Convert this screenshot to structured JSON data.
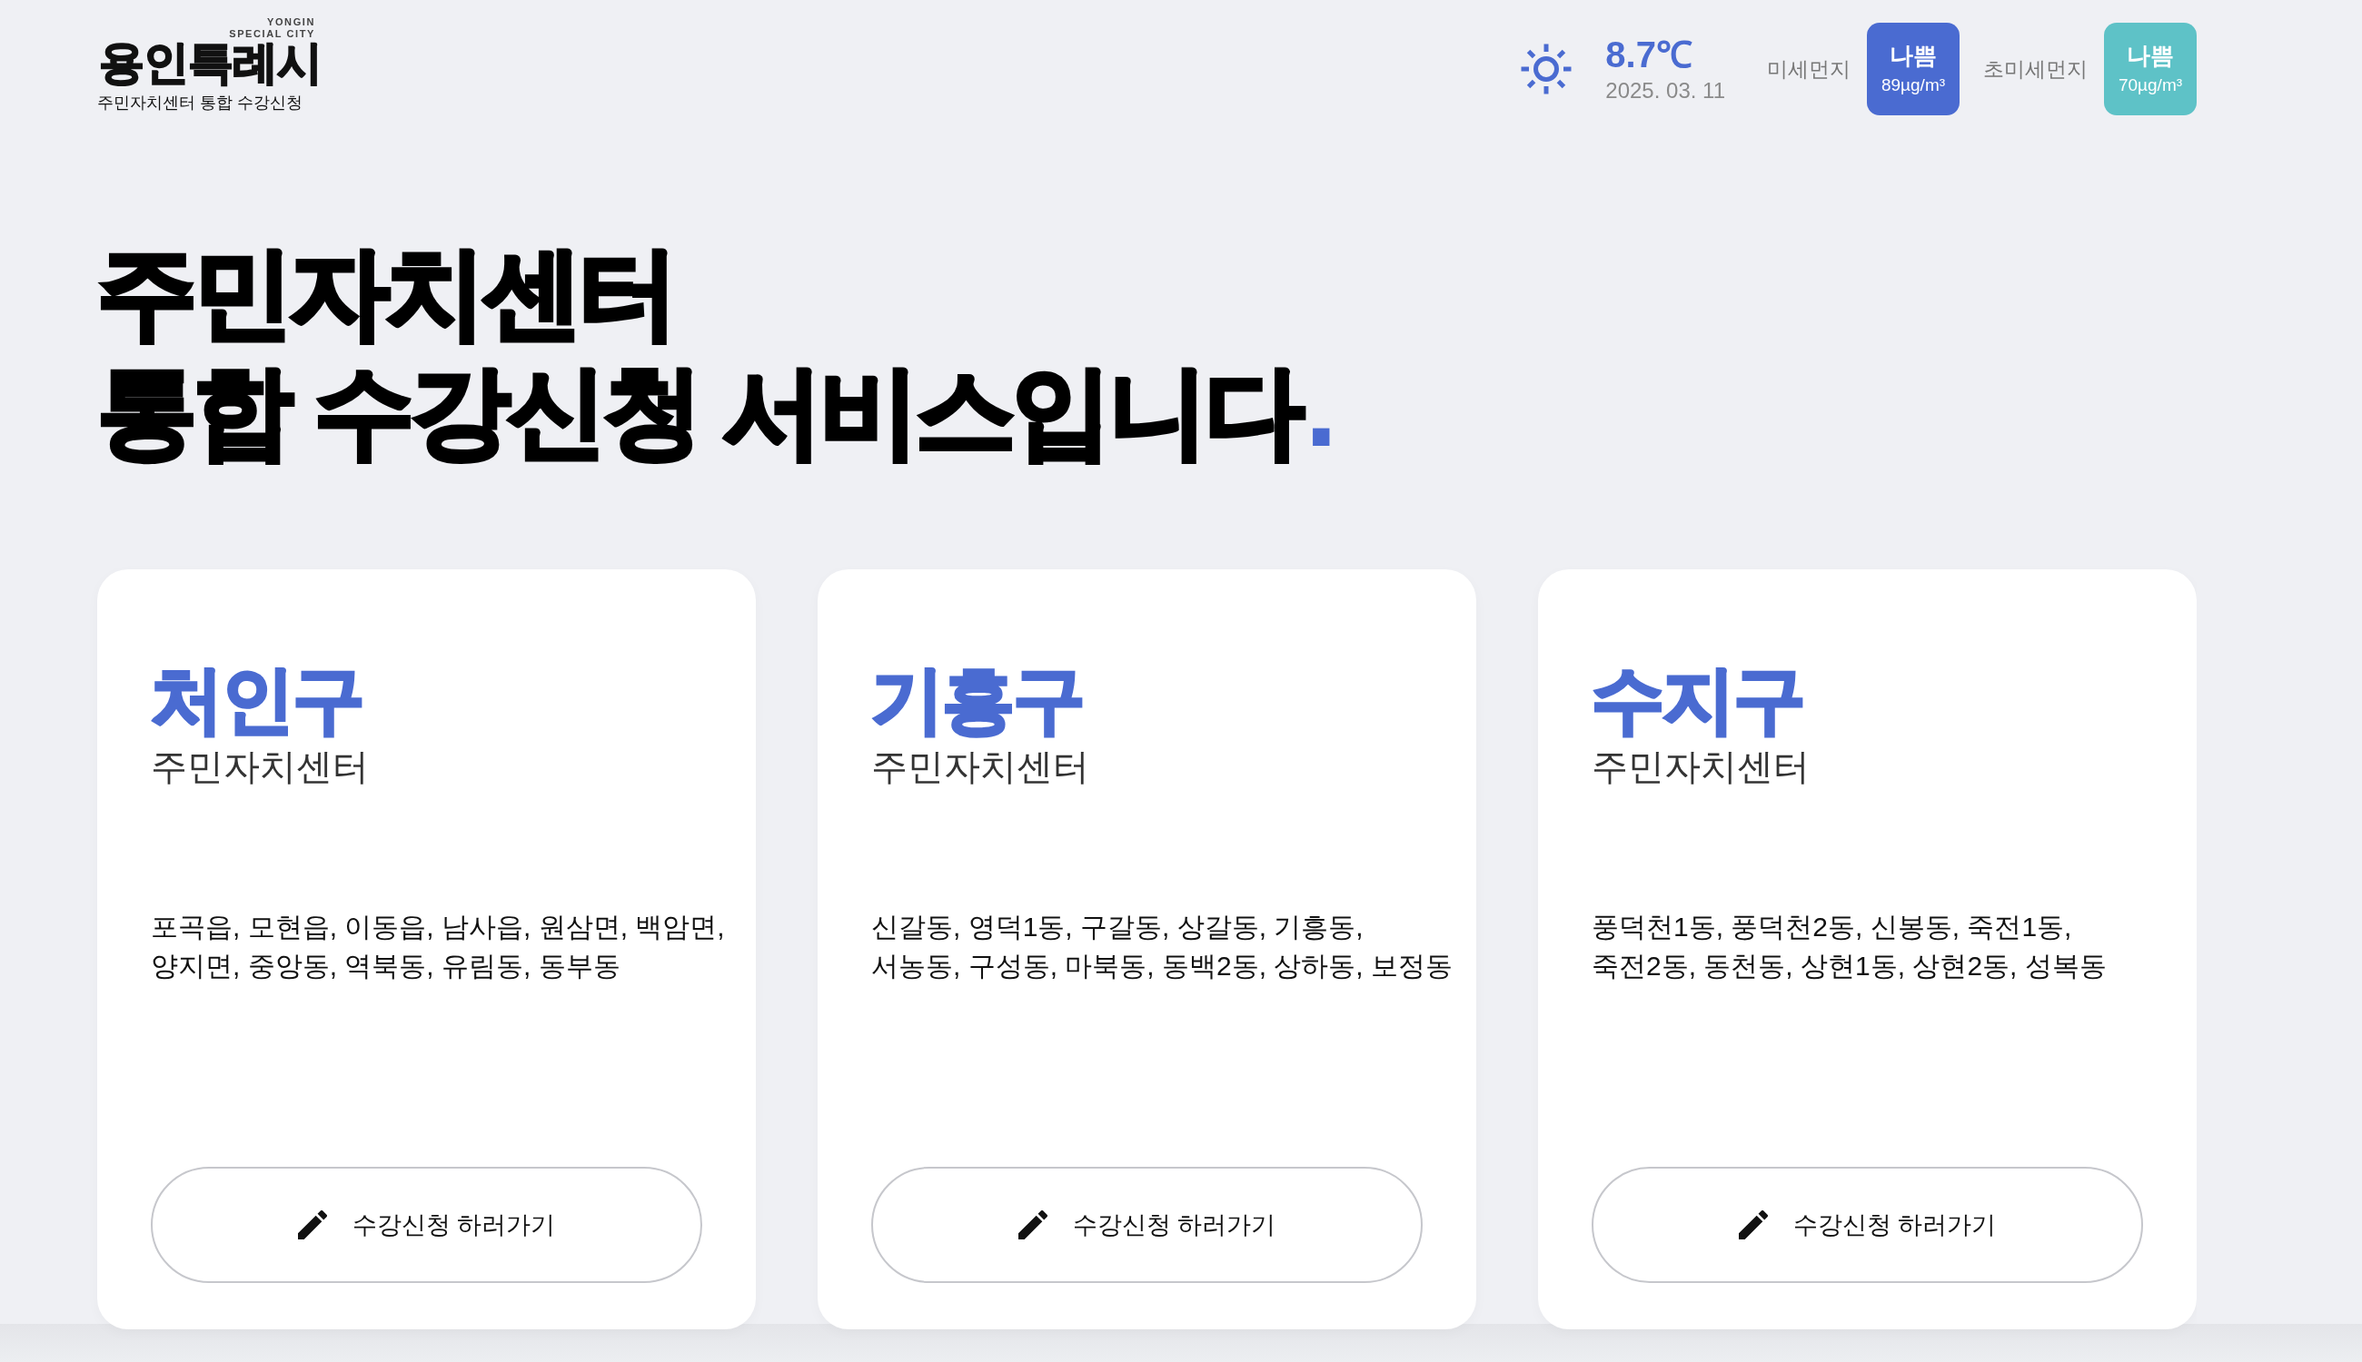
{
  "header": {
    "logo": {
      "english_lines": [
        "YONGIN",
        "SPECIAL CITY"
      ],
      "wordmark": "용인특례시",
      "subtitle": "주민자치센터 통합 수강신청"
    },
    "weather": {
      "temperature": "8.7℃",
      "date": "2025. 03. 11"
    },
    "air_quality": [
      {
        "label": "미세먼지",
        "grade": "나쁨",
        "reading": "89µg/m³",
        "color": "#4a6bd1"
      },
      {
        "label": "초미세먼지",
        "grade": "나쁨",
        "reading": "70µg/m³",
        "color": "#5ec2c7"
      }
    ]
  },
  "headline": {
    "lines": [
      "주민자치센터",
      "통합 수강신청 서비스입니다"
    ],
    "end_mark": "."
  },
  "districts": [
    {
      "name": "처인구",
      "subtitle": "주민자치센터",
      "area_lines": [
        "포곡읍, 모현읍, 이동읍, 남사읍, 원삼면, 백암면,",
        "양지면, 중앙동, 역북동, 유림동, 동부동"
      ],
      "button": "수강신청 하러가기"
    },
    {
      "name": "기흥구",
      "subtitle": "주민자치센터",
      "area_lines": [
        "신갈동, 영덕1동, 구갈동, 상갈동, 기흥동,",
        "서농동, 구성동, 마북동, 동백2동, 상하동, 보정동"
      ],
      "button": "수강신청 하러가기"
    },
    {
      "name": "수지구",
      "subtitle": "주민자치센터",
      "area_lines": [
        "풍덕천1동, 풍덕천2동, 신봉동, 죽전1동,",
        "죽전2동, 동천동, 상현1동, 상현2동, 성복동"
      ],
      "button": "수강신청 하러가기"
    }
  ]
}
